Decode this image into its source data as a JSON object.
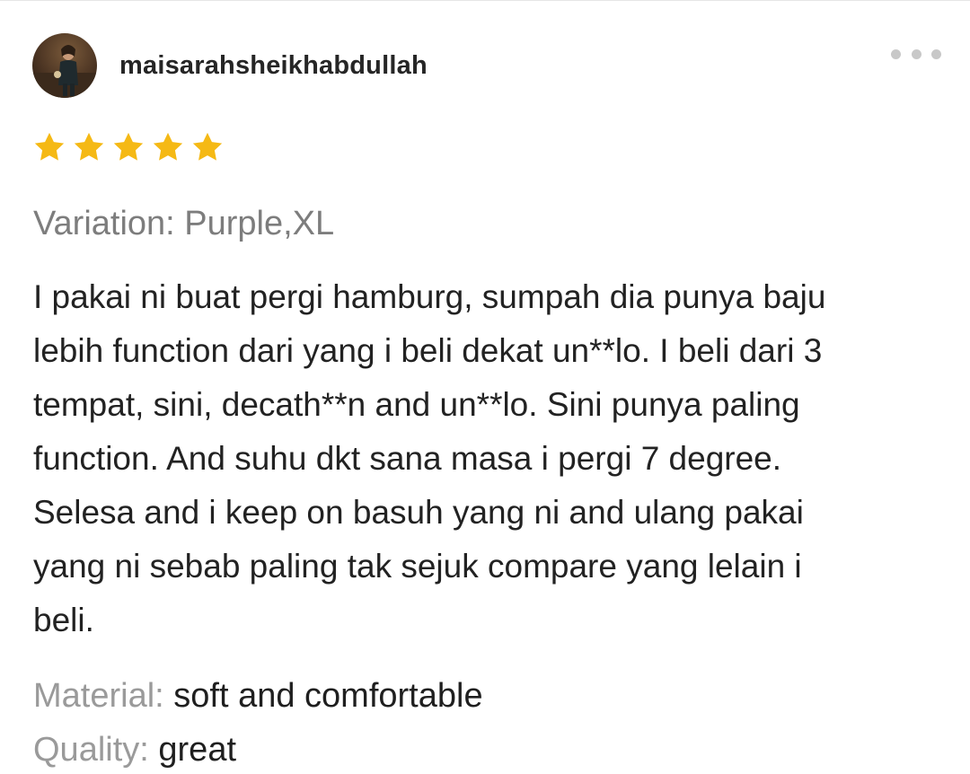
{
  "review": {
    "username": "maisarahsheikhabdullah",
    "rating": 5,
    "rating_max": 5,
    "variation": "Variation: Purple,XL",
    "text_lines": [
      "I pakai ni buat pergi hamburg, sumpah dia punya baju",
      "lebih function dari yang i beli dekat un**lo. I beli dari 3",
      "tempat, sini, decath**n and un**lo. Sini punya paling",
      "function. And suhu dkt sana masa i pergi 7 degree.",
      "Selesa and i keep on basuh yang ni and ulang pakai",
      "yang ni sebab paling tak sejuk compare yang lelain i",
      "beli."
    ],
    "attributes": [
      {
        "key": "Material: ",
        "value": "soft and comfortable"
      },
      {
        "key": "Quality: ",
        "value": "great"
      }
    ]
  },
  "icons": {
    "more": "more-horizontal-icon",
    "star": "star-icon",
    "avatar": "user-avatar"
  },
  "colors": {
    "star": "#f5b915",
    "variation_text": "#7d7d7d",
    "attribute_key": "#9a9a9a",
    "body_text": "#222222",
    "more_dots": "#c8c8c8"
  }
}
